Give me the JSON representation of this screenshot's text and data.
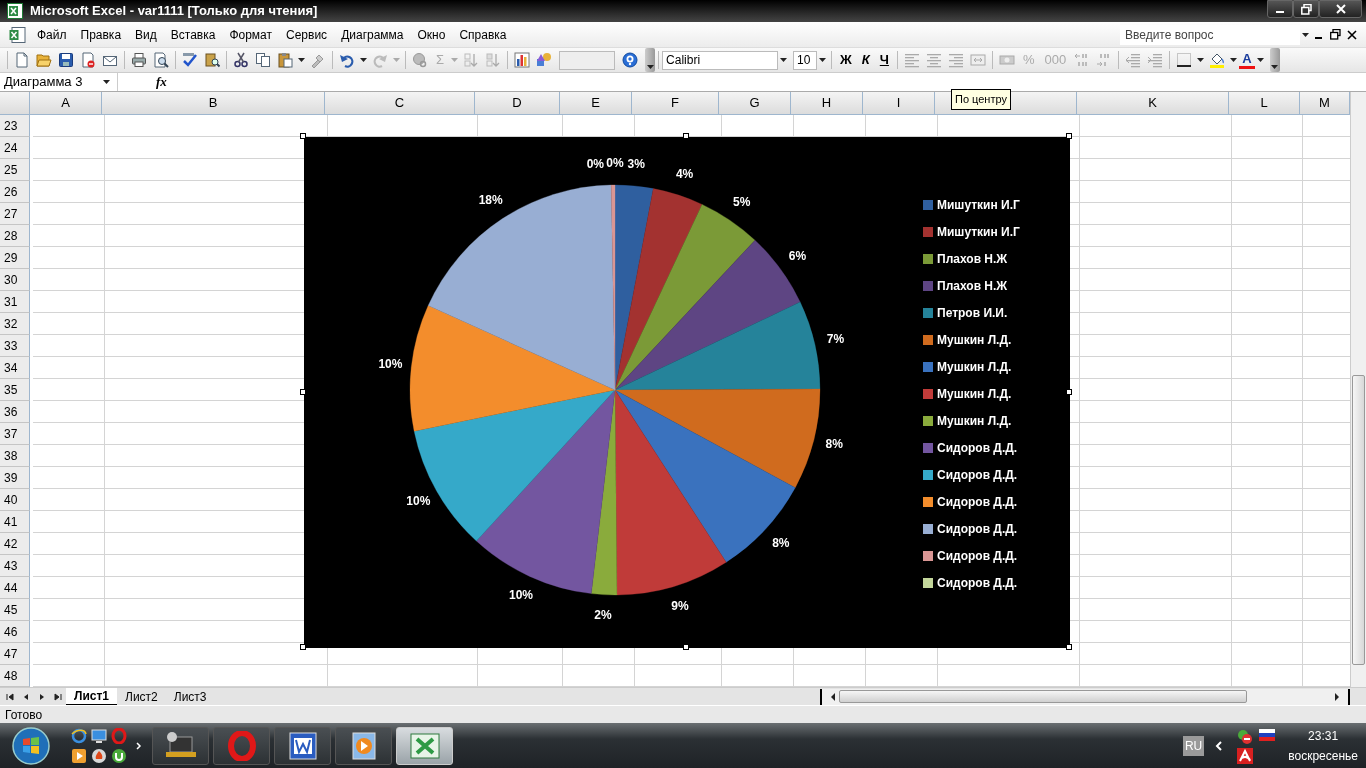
{
  "window": {
    "title": "Microsoft Excel - var1111  [Только для чтения]"
  },
  "menu": {
    "items": [
      "Файл",
      "Правка",
      "Вид",
      "Вставка",
      "Формат",
      "Сервис",
      "Диаграмма",
      "Окно",
      "Справка"
    ],
    "help_search": {
      "placeholder": "Введите вопрос"
    }
  },
  "standard_toolbar": {
    "autosum": "Σ"
  },
  "formatting_toolbar": {
    "font": "Calibri",
    "font_size": "10",
    "bold": "Ж",
    "italic": "К",
    "underline": "Ч",
    "percent": "%",
    "thousands": "000",
    "font_color": "A"
  },
  "formula_bar": {
    "name_box": "Диаграмма 3",
    "function_label": "fx"
  },
  "tooltip": "По центру",
  "sheet": {
    "columns": [
      "A",
      "B",
      "C",
      "D",
      "E",
      "F",
      "G",
      "H",
      "I",
      null,
      "K",
      "L",
      "M"
    ],
    "rows": [
      "23",
      "24",
      "25",
      "26",
      "27",
      "28",
      "29",
      "30",
      "31",
      "32",
      "33",
      "34",
      "35",
      "36",
      "37",
      "38",
      "39",
      "40",
      "41",
      "42",
      "43",
      "44",
      "45",
      "46",
      "47",
      "48"
    ],
    "chart": {
      "chart_data": {
        "type": "pie",
        "categories": [
          "Мишуткин И.Г",
          "Мишуткин И.Г",
          "Плахов Н.Ж",
          "Плахов Н.Ж",
          "Петров И.И.",
          "Мушкин Л.Д.",
          "Мушкин Л.Д.",
          "Мушкин Л.Д.",
          "Мушкин Л.Д.",
          "Сидоров Д.Д.",
          "Сидоров Д.Д.",
          "Сидоров Д.Д.",
          "Сидоров Д.Д.",
          "Сидоров Д.Д.",
          "Сидоров Д.Д."
        ],
        "values": [
          3,
          4,
          5,
          6,
          7,
          8,
          8,
          9,
          2,
          10,
          10,
          10,
          18,
          0.3,
          0
        ],
        "value_labels": [
          "3%",
          "4%",
          "5%",
          "6%",
          "7%",
          "8%",
          "8%",
          "9%",
          "2%",
          "10%",
          "10%",
          "10%",
          "18%",
          "0%",
          "0%"
        ],
        "legend": "right",
        "colors": [
          "#2f5f9f",
          "#a33230",
          "#7b9a37",
          "#5e4583",
          "#25839a",
          "#d06b1e",
          "#3a72be",
          "#c03b39",
          "#8aab3c",
          "#7356a0",
          "#35a9c9",
          "#f38d2c",
          "#98aed3",
          "#d99694",
          "#c3d69b"
        ]
      }
    }
  },
  "sheet_tabs": [
    {
      "label": "Лист1",
      "selected": true
    },
    {
      "label": "Лист2",
      "selected": false
    },
    {
      "label": "Лист3",
      "selected": false
    }
  ],
  "status_bar": {
    "text": "Готово"
  },
  "taskbar": {
    "buttons": [
      {
        "active": false
      },
      {
        "active": false
      },
      {
        "active": false
      },
      {
        "active": false
      },
      {
        "active": true
      }
    ],
    "language": "RU",
    "time": "23:31",
    "day": "воскресенье"
  }
}
